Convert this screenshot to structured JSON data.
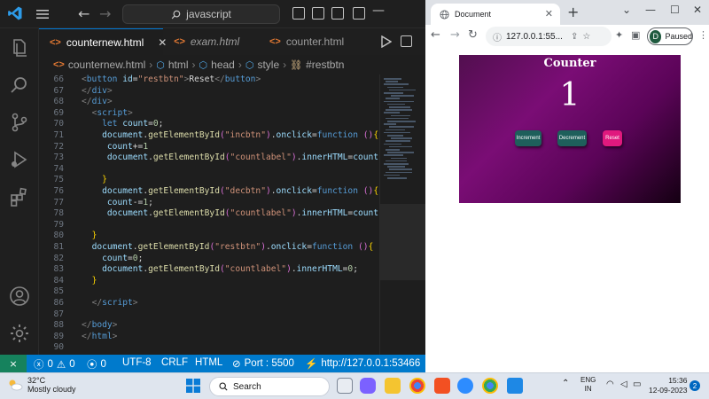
{
  "vscode": {
    "search_text": "javascript",
    "tabs": [
      {
        "label": "counternew.html",
        "active": true,
        "italic": false
      },
      {
        "label": "exam.html",
        "active": false,
        "italic": true
      },
      {
        "label": "counter.html",
        "active": false,
        "italic": false
      }
    ],
    "breadcrumb": [
      "counternew.html",
      "html",
      "head",
      "style",
      "#restbtn"
    ],
    "code_lines": [
      {
        "n": "66",
        "html": "<span class='t-br'>&lt;</span><span class='t-tag'>button</span> <span class='t-var'>id</span>=<span class='t-str'>\"restbtn\"</span><span class='t-br'>&gt;</span>Reset<span class='t-br'>&lt;/</span><span class='t-tag'>button</span><span class='t-br'>&gt;</span>"
      },
      {
        "n": "67",
        "html": "<span class='t-br'>&lt;/</span><span class='t-tag'>div</span><span class='t-br'>&gt;</span>"
      },
      {
        "n": "68",
        "html": "<span class='t-br'>&lt;/</span><span class='t-tag'>div</span><span class='t-br'>&gt;</span>"
      },
      {
        "n": "69",
        "html": "  <span class='t-br'>&lt;</span><span class='t-tag'>script</span><span class='t-br'>&gt;</span>"
      },
      {
        "n": "70",
        "html": "    <span class='t-kw'>let</span> <span class='t-var'>count</span>=<span class='t-num'>0</span>;"
      },
      {
        "n": "71",
        "html": "    <span class='t-var'>document</span>.<span class='t-fn'>getElementById</span><span class='t-par'>(</span><span class='t-str'>\"incbtn\"</span><span class='t-par'>)</span>.<span class='t-var'>onclick</span>=<span class='t-kw'>function</span> <span class='t-par'>()</span><span class='t-ob'>{</span>"
      },
      {
        "n": "72",
        "html": "     <span class='t-var'>count</span>+=<span class='t-num'>1</span>"
      },
      {
        "n": "73",
        "html": "     <span class='t-var'>document</span>.<span class='t-fn'>getElementById</span><span class='t-par'>(</span><span class='t-str'>\"countlabel\"</span><span class='t-par'>)</span>.<span class='t-var'>innerHTML</span>=<span class='t-var'>count</span>;"
      },
      {
        "n": "74",
        "html": ""
      },
      {
        "n": "75",
        "html": "    <span class='t-ob'>}</span>"
      },
      {
        "n": "76",
        "html": "    <span class='t-var'>document</span>.<span class='t-fn'>getElementById</span><span class='t-par'>(</span><span class='t-str'>\"decbtn\"</span><span class='t-par'>)</span>.<span class='t-var'>onclick</span>=<span class='t-kw'>function</span> <span class='t-par'>()</span><span class='t-ob'>{</span>"
      },
      {
        "n": "77",
        "html": "     <span class='t-var'>count</span>-=<span class='t-num'>1</span>;"
      },
      {
        "n": "78",
        "html": "     <span class='t-var'>document</span>.<span class='t-fn'>getElementById</span><span class='t-par'>(</span><span class='t-str'>\"countlabel\"</span><span class='t-par'>)</span>.<span class='t-var'>innerHTML</span>=<span class='t-var'>count</span>;"
      },
      {
        "n": "79",
        "html": ""
      },
      {
        "n": "80",
        "html": "  <span class='t-ob'>}</span>"
      },
      {
        "n": "81",
        "html": "  <span class='t-var'>document</span>.<span class='t-fn'>getElementById</span><span class='t-par'>(</span><span class='t-str'>\"restbtn\"</span><span class='t-par'>)</span>.<span class='t-var'>onclick</span>=<span class='t-kw'>function</span> <span class='t-par'>()</span><span class='t-ob'>{</span>"
      },
      {
        "n": "82",
        "html": "    <span class='t-var'>count</span>=<span class='t-num'>0</span>;"
      },
      {
        "n": "83",
        "html": "    <span class='t-var'>document</span>.<span class='t-fn'>getElementById</span><span class='t-par'>(</span><span class='t-str'>\"countlabel\"</span><span class='t-par'>)</span>.<span class='t-var'>innerHTML</span>=<span class='t-num'>0</span>;"
      },
      {
        "n": "84",
        "html": "  <span class='t-ob'>}</span>"
      },
      {
        "n": "85",
        "html": ""
      },
      {
        "n": "86",
        "html": "  <span class='t-br'>&lt;/</span><span class='t-tag'>script</span><span class='t-br'>&gt;</span>"
      },
      {
        "n": "87",
        "html": ""
      },
      {
        "n": "88",
        "html": "<span class='t-br'>&lt;/</span><span class='t-tag'>body</span><span class='t-br'>&gt;</span>"
      },
      {
        "n": "89",
        "html": "<span class='t-br'>&lt;/</span><span class='t-tag'>html</span><span class='t-br'>&gt;</span>"
      },
      {
        "n": "90",
        "html": ""
      }
    ],
    "status": {
      "errors": "0",
      "warnings": "0",
      "ports": "0",
      "encoding": "UTF-8",
      "eol": "CRLF",
      "language": "HTML",
      "port_label": "Port : 5500",
      "live_url": "http://127.0.0.1:53466"
    }
  },
  "chrome": {
    "tab_title": "Document",
    "url": "127.0.0.1:55...",
    "profile_initial": "D",
    "profile_label": "Paused"
  },
  "counter_page": {
    "title": "Counter",
    "value": "1",
    "buttons": {
      "increment": "Increment",
      "decrement": "Decrement",
      "reset": "Reset"
    }
  },
  "taskbar": {
    "temperature": "32°C",
    "condition": "Mostly cloudy",
    "search_label": "Search",
    "lang_line1": "ENG",
    "lang_line2": "IN",
    "time": "15:36",
    "date": "12-09-2023",
    "notification_count": "2"
  },
  "colors": {
    "vscode_accent": "#007acc",
    "remote_indicator": "#16825d",
    "counter_bg": "#7a0d75",
    "button_teal": "#1e5f5b",
    "button_reset": "#e0197e"
  }
}
